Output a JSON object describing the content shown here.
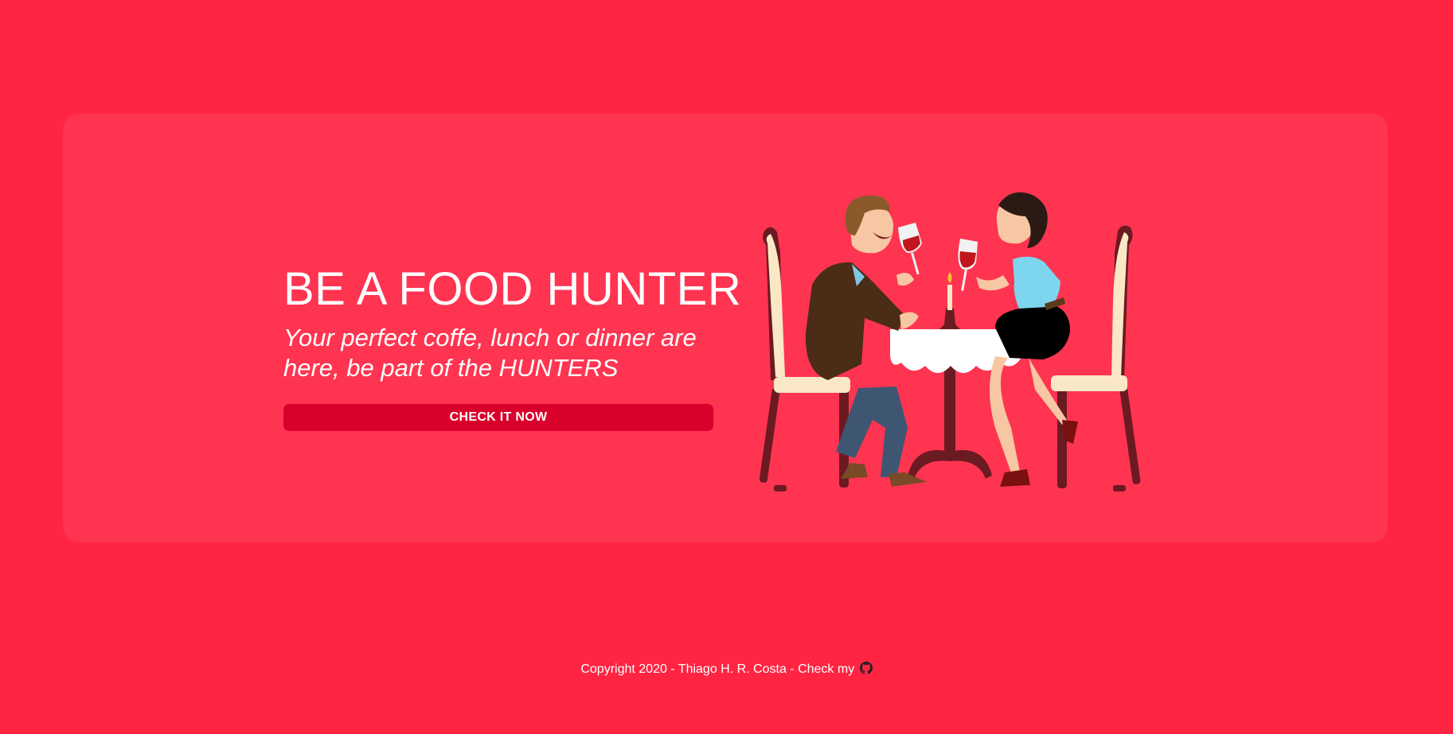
{
  "hero": {
    "title": "BE A FOOD HUNTER",
    "subtitle": "Your perfect coffe, lunch or dinner are here, be part of the HUNTERS",
    "cta_label": "CHECK IT NOW"
  },
  "illustration": {
    "icon": "couple-dining-illustration"
  },
  "footer": {
    "text": "Copyright 2020 - Thiago H. R. Costa - Check my",
    "link_icon": "github-icon"
  },
  "colors": {
    "background": "#ff2442",
    "card": "#ff3451",
    "button": "#d9002c",
    "text": "#ffffff"
  }
}
